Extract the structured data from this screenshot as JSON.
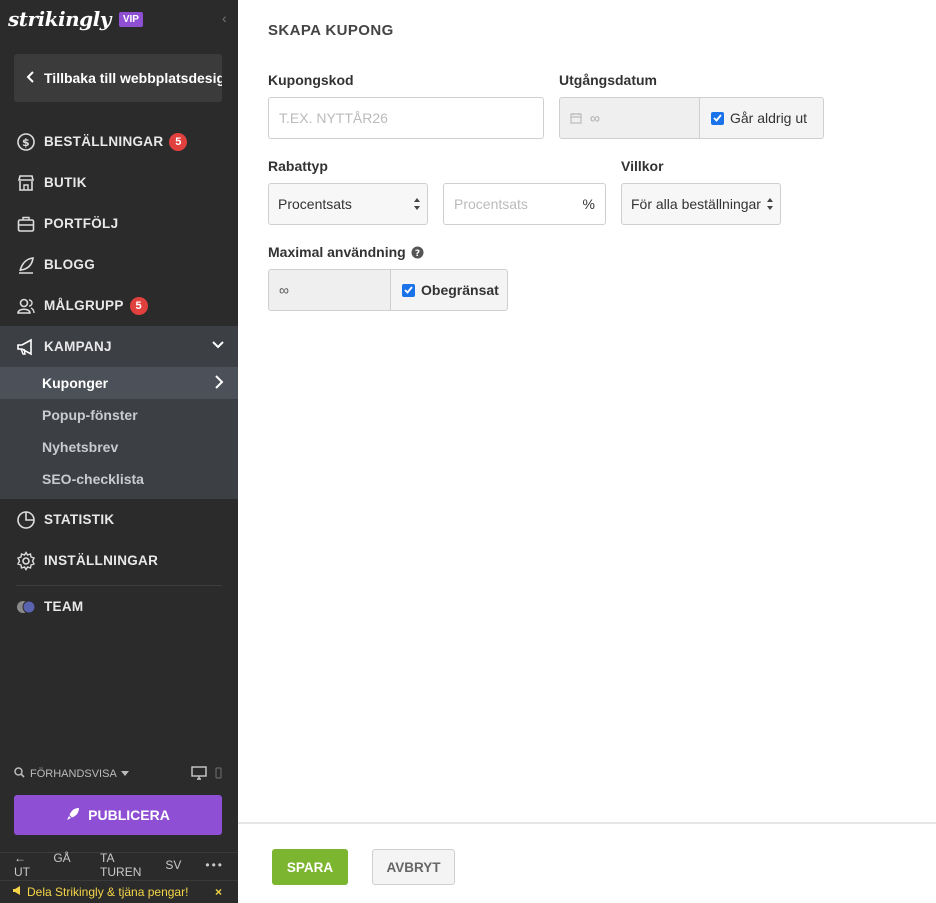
{
  "sidebar": {
    "logo": "strikingly",
    "vip_badge": "VIP",
    "back_label": "Tillbaka till webbplatsdesign",
    "items": [
      {
        "label": "BESTÄLLNINGAR",
        "badge": "5",
        "icon": "dollar-icon"
      },
      {
        "label": "BUTIK",
        "icon": "store-icon"
      },
      {
        "label": "PORTFÖLJ",
        "icon": "briefcase-icon"
      },
      {
        "label": "BLOGG",
        "icon": "pen-icon"
      },
      {
        "label": "MÅLGRUPP",
        "badge": "5",
        "icon": "users-icon"
      },
      {
        "label": "KAMPANJ",
        "icon": "megaphone-icon"
      },
      {
        "label": "STATISTIK",
        "icon": "pie-chart-icon"
      },
      {
        "label": "INSTÄLLNINGAR",
        "icon": "gear-icon"
      },
      {
        "label": "TEAM",
        "icon": "team-avatars-icon"
      }
    ],
    "kampanj_sub": [
      "Kuponger",
      "Popup-fönster",
      "Nyhetsbrev",
      "SEO-checklista"
    ],
    "preview_label": "FÖRHANDSVISA",
    "publish_label": "PUBLICERA",
    "footer": {
      "logout": "GÅ UT",
      "tour": "TA TUREN",
      "lang": "SV",
      "more": "•••"
    },
    "share_label": "Dela Strikingly & tjäna pengar!",
    "share_close": "×"
  },
  "form": {
    "title": "SKAPA KUPONG",
    "code_label": "Kupongskod",
    "code_placeholder": "T.EX. NYTTÅR26",
    "expiry_label": "Utgångsdatum",
    "expiry_value": "∞",
    "never_expires_label": "Går aldrig ut",
    "discount_label": "Rabattyp",
    "discount_type": "Procentsats",
    "discount_value_placeholder": "Procentsats",
    "discount_suffix": "%",
    "terms_label": "Villkor",
    "terms_value": "För alla beställningar",
    "max_usage_label": "Maximal användning",
    "max_usage_value": "∞",
    "unlimited_label": "Obegränsat",
    "save_label": "SPARA",
    "cancel_label": "AVBRYT"
  },
  "colors": {
    "sidebar_bg": "#2b2b2b",
    "accent_purple": "#8e4fd4",
    "save_green": "#7cb52f",
    "badge_red": "#e0413e"
  }
}
